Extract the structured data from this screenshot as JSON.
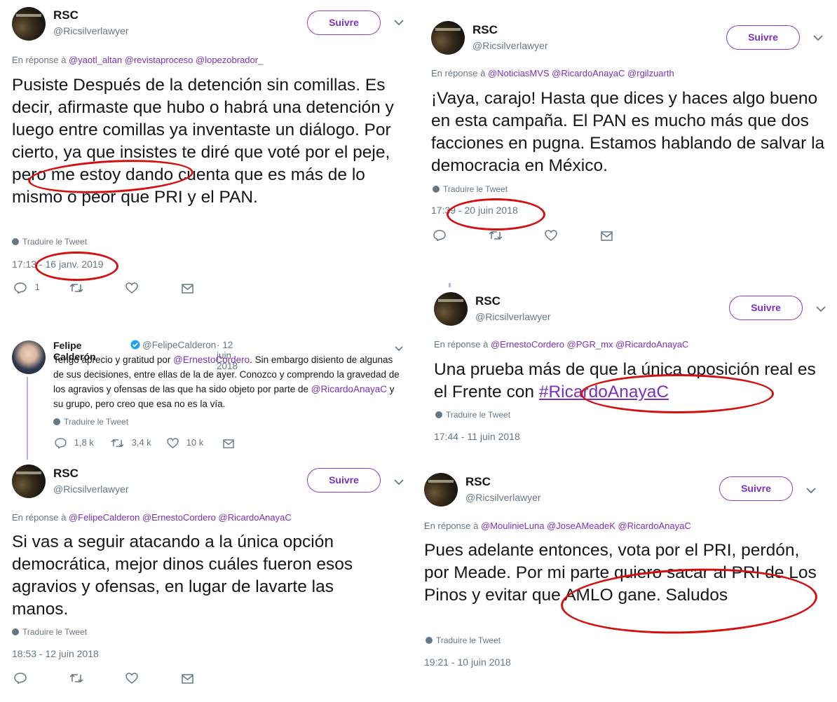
{
  "tweets": [
    {
      "name": "RSC",
      "handle": "@Ricsilverlawyer",
      "follow": "Suivre",
      "reply_prefix": "En réponse à",
      "mentions": "@yaotl_altan @revistaproceso @lopezobrador_",
      "text": "Pusiste Después de la detención sin comillas. Es decir, afirmaste que hubo o habrá una detención y luego entre comillas ya inventaste un diálogo. Por cierto, ya que insistes te diré que voté por el peje, pero me estoy dando cuenta que es más de lo mismo o peor que PRI y el PAN.",
      "translate": "Traduire le Tweet",
      "time": "17:13 - 16 janv. 2019",
      "reply_count": "1"
    },
    {
      "name": "RSC",
      "handle": "@Ricsilverlawyer",
      "follow": "Suivre",
      "reply_prefix": "En réponse à",
      "mentions": "@NoticiasMVS @RicardoAnayaC @rgilzuarth",
      "text": "¡Vaya, carajo! Hasta que dices y haces algo bueno en esta campaña. El PAN es mucho más que dos facciones en pugna. Estamos hablando de salvar la democracia en México.",
      "translate": "Traduire le Tweet",
      "time": "17:39 - 20 juin 2018"
    },
    {
      "name": "RSC",
      "handle": "@Ricsilverlawyer",
      "follow": "Suivre",
      "reply_prefix": "En réponse à",
      "mentions": "@ErnestoCordero @PGR_mx @RicardoAnayaC",
      "text": "Una prueba más de que la única oposición real es el Frente con ",
      "hashtag": "#RicardoAnayaC",
      "translate": "Traduire le Tweet",
      "time": "17:44 - 11 juin 2018"
    },
    {
      "name": "Felipe Calderón",
      "handle": "@FelipeCalderon",
      "date": "· 12 juin 2018",
      "text_a": "Tengo aprecio y gratitud por ",
      "mention1": "@ErnestoCordero",
      "text_b": ". Sin embargo disiento de algunas de sus decisiones, entre ellas de la de ayer. Conozco y comprendo la gravedad de los agravios y ofensas de las que ha sido objeto por parte de ",
      "mention2": "@RicardoAnayaC",
      "text_c": " y su grupo, pero creo que esa no es la vía.",
      "translate": "Traduire le Tweet",
      "replies": "1,8 k",
      "retweets": "3,4 k",
      "likes": "10 k"
    },
    {
      "name": "RSC",
      "handle": "@Ricsilverlawyer",
      "follow": "Suivre",
      "reply_prefix": "En réponse à",
      "mentions": "@FelipeCalderon @ErnestoCordero @RicardoAnayaC",
      "text": "Si vas a seguir atacando a la única opción democrática, mejor dinos cuáles fueron esos agravios y ofensas, en lugar de lavarte las manos.",
      "translate": "Traduire le Tweet",
      "time": "18:53 - 12 juin 2018"
    },
    {
      "name": "RSC",
      "handle": "@Ricsilverlawyer",
      "follow": "Suivre",
      "reply_prefix": "En réponse à",
      "mentions": "@MoulinieLuna @JoseAMeadeK @RicardoAnayaC",
      "text": "Pues adelante entonces, vota por el PRI, perdón, por Meade. Por mi parte quiero sacar al PRI de Los Pinos y evitar que AMLO gane. Saludos",
      "translate": "Traduire le Tweet",
      "time": "19:21 - 10 juin 2018"
    }
  ],
  "icons": [
    "reply-icon",
    "retweet-icon",
    "like-icon",
    "message-icon",
    "globe-icon",
    "chevron-down-icon",
    "verified-icon"
  ],
  "colors": {
    "accent": "#7b2fbf",
    "annotation": "#d3100f",
    "muted": "#657786"
  }
}
